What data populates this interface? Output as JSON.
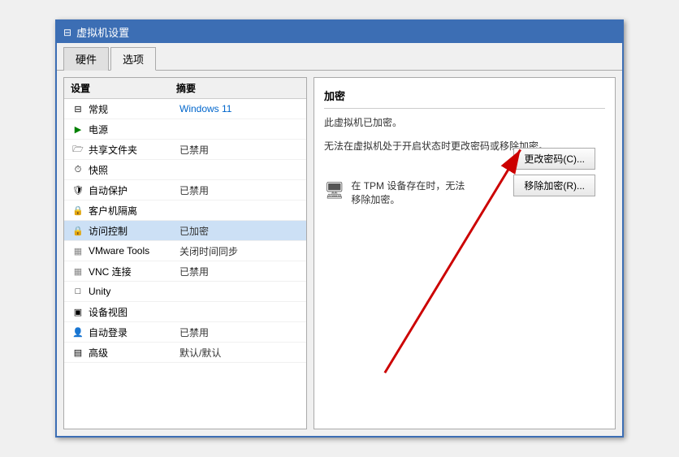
{
  "window": {
    "title": "虚拟机设置"
  },
  "tabs": [
    {
      "label": "硬件",
      "active": false
    },
    {
      "label": "选项",
      "active": true
    }
  ],
  "listHeader": {
    "setting": "设置",
    "summary": "摘要"
  },
  "listItems": [
    {
      "icon": "⊟",
      "name": "常规",
      "summary": "Windows 11",
      "summaryColor": "blue",
      "selected": false
    },
    {
      "icon": "▶",
      "name": "电源",
      "summary": "",
      "summaryColor": "normal",
      "selected": false
    },
    {
      "icon": "🗁",
      "name": "共享文件夹",
      "summary": "已禁用",
      "summaryColor": "normal",
      "selected": false
    },
    {
      "icon": "⏱",
      "name": "快照",
      "summary": "",
      "summaryColor": "normal",
      "selected": false
    },
    {
      "icon": "🛡",
      "name": "自动保护",
      "summary": "已禁用",
      "summaryColor": "normal",
      "selected": false
    },
    {
      "icon": "🔒",
      "name": "客户机隔离",
      "summary": "",
      "summaryColor": "normal",
      "selected": false
    },
    {
      "icon": "🔒",
      "name": "访问控制",
      "summary": "已加密",
      "summaryColor": "normal",
      "selected": true
    },
    {
      "icon": "▦",
      "name": "VMware Tools",
      "summary": "关闭时间同步",
      "summaryColor": "normal",
      "selected": false
    },
    {
      "icon": "▦",
      "name": "VNC 连接",
      "summary": "已禁用",
      "summaryColor": "normal",
      "selected": false
    },
    {
      "icon": "□",
      "name": "Unity",
      "summary": "",
      "summaryColor": "normal",
      "selected": false
    },
    {
      "icon": "▣",
      "name": "设备视图",
      "summary": "",
      "summaryColor": "normal",
      "selected": false
    },
    {
      "icon": "👤",
      "name": "自动登录",
      "summary": "已禁用",
      "summaryColor": "normal",
      "selected": false
    },
    {
      "icon": "▤",
      "name": "高级",
      "summary": "默认/默认",
      "summaryColor": "normal",
      "selected": false
    }
  ],
  "rightPanel": {
    "title": "加密",
    "desc1": "此虚拟机已加密。",
    "desc2": "无法在虚拟机处于开启状态时更改密码或移除加密。",
    "btn_change": "更改密码(C)...",
    "btn_remove": "移除加密(R)...",
    "tpm_text": "在 TPM 设备存在时，无法移除加密。"
  }
}
